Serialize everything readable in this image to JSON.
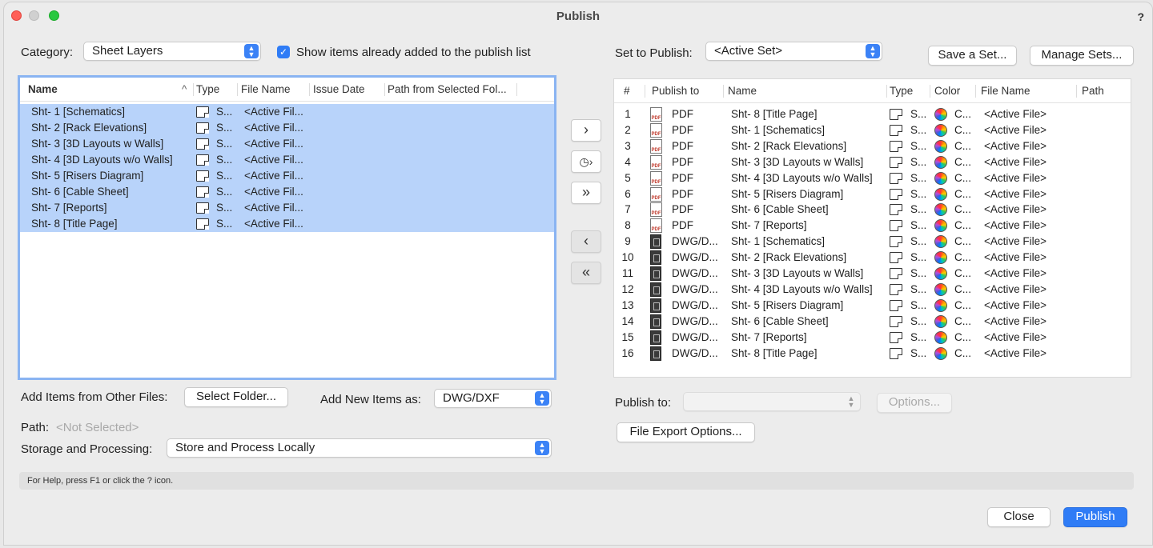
{
  "window": {
    "title": "Publish",
    "help": "?"
  },
  "left": {
    "category_label": "Category:",
    "category_value": "Sheet Layers",
    "show_items_label": "Show items already added to the publish list",
    "columns": [
      "Name",
      "Type",
      "File Name",
      "Issue Date",
      "Path from Selected Fol..."
    ],
    "rows": [
      {
        "name": "Sht- 1 [Schematics]",
        "type": "S...",
        "file": "<Active Fil..."
      },
      {
        "name": "Sht- 2 [Rack Elevations]",
        "type": "S...",
        "file": "<Active Fil..."
      },
      {
        "name": "Sht- 3 [3D Layouts w Walls]",
        "type": "S...",
        "file": "<Active Fil..."
      },
      {
        "name": "Sht- 4 [3D Layouts w/o Walls]",
        "type": "S...",
        "file": "<Active Fil..."
      },
      {
        "name": "Sht- 5 [Risers Diagram]",
        "type": "S...",
        "file": "<Active Fil..."
      },
      {
        "name": "Sht- 6 [Cable Sheet]",
        "type": "S...",
        "file": "<Active Fil..."
      },
      {
        "name": "Sht- 7 [Reports]",
        "type": "S...",
        "file": "<Active Fil..."
      },
      {
        "name": "Sht- 8 [Title Page]",
        "type": "S...",
        "file": "<Active Fil..."
      }
    ],
    "add_items_label": "Add Items from Other Files:",
    "select_folder": "Select Folder...",
    "add_new_label": "Add New Items as:",
    "add_new_value": "DWG/DXF",
    "path_label": "Path:",
    "path_value": "<Not Selected>",
    "storage_label": "Storage and Processing:",
    "storage_value": "Store and Process Locally"
  },
  "right": {
    "set_label": "Set to Publish:",
    "set_value": "<Active Set>",
    "save_set": "Save a Set...",
    "manage_sets": "Manage Sets...",
    "columns": [
      "#",
      "Publish to",
      "Name",
      "Type",
      "Color",
      "File Name",
      "Path"
    ],
    "rows": [
      {
        "num": "1",
        "publish": "PDF",
        "kind": "pdf",
        "name": "Sht- 8 [Title Page]",
        "type": "S...",
        "color": "C...",
        "file": "<Active File>"
      },
      {
        "num": "2",
        "publish": "PDF",
        "kind": "pdf",
        "name": "Sht- 1 [Schematics]",
        "type": "S...",
        "color": "C...",
        "file": "<Active File>"
      },
      {
        "num": "3",
        "publish": "PDF",
        "kind": "pdf",
        "name": "Sht- 2 [Rack Elevations]",
        "type": "S...",
        "color": "C...",
        "file": "<Active File>"
      },
      {
        "num": "4",
        "publish": "PDF",
        "kind": "pdf",
        "name": "Sht- 3 [3D Layouts w Walls]",
        "type": "S...",
        "color": "C...",
        "file": "<Active File>"
      },
      {
        "num": "5",
        "publish": "PDF",
        "kind": "pdf",
        "name": "Sht- 4 [3D Layouts w/o Walls]",
        "type": "S...",
        "color": "C...",
        "file": "<Active File>"
      },
      {
        "num": "6",
        "publish": "PDF",
        "kind": "pdf",
        "name": "Sht- 5 [Risers Diagram]",
        "type": "S...",
        "color": "C...",
        "file": "<Active File>"
      },
      {
        "num": "7",
        "publish": "PDF",
        "kind": "pdf",
        "name": "Sht- 6 [Cable Sheet]",
        "type": "S...",
        "color": "C...",
        "file": "<Active File>"
      },
      {
        "num": "8",
        "publish": "PDF",
        "kind": "pdf",
        "name": "Sht- 7 [Reports]",
        "type": "S...",
        "color": "C...",
        "file": "<Active File>"
      },
      {
        "num": "9",
        "publish": "DWG/D...",
        "kind": "dwg",
        "name": "Sht- 1 [Schematics]",
        "type": "S...",
        "color": "C...",
        "file": "<Active File>"
      },
      {
        "num": "10",
        "publish": "DWG/D...",
        "kind": "dwg",
        "name": "Sht- 2 [Rack Elevations]",
        "type": "S...",
        "color": "C...",
        "file": "<Active File>"
      },
      {
        "num": "11",
        "publish": "DWG/D...",
        "kind": "dwg",
        "name": "Sht- 3 [3D Layouts w Walls]",
        "type": "S...",
        "color": "C...",
        "file": "<Active File>"
      },
      {
        "num": "12",
        "publish": "DWG/D...",
        "kind": "dwg",
        "name": "Sht- 4 [3D Layouts w/o Walls]",
        "type": "S...",
        "color": "C...",
        "file": "<Active File>"
      },
      {
        "num": "13",
        "publish": "DWG/D...",
        "kind": "dwg",
        "name": "Sht- 5 [Risers Diagram]",
        "type": "S...",
        "color": "C...",
        "file": "<Active File>"
      },
      {
        "num": "14",
        "publish": "DWG/D...",
        "kind": "dwg",
        "name": "Sht- 6 [Cable Sheet]",
        "type": "S...",
        "color": "C...",
        "file": "<Active File>"
      },
      {
        "num": "15",
        "publish": "DWG/D...",
        "kind": "dwg",
        "name": "Sht- 7 [Reports]",
        "type": "S...",
        "color": "C...",
        "file": "<Active File>"
      },
      {
        "num": "16",
        "publish": "DWG/D...",
        "kind": "dwg",
        "name": "Sht- 8 [Title Page]",
        "type": "S...",
        "color": "C...",
        "file": "<Active File>"
      }
    ],
    "publish_to_label": "Publish to:",
    "publish_to_value": "",
    "options": "Options...",
    "file_export_options": "File Export Options..."
  },
  "status_text": "For Help, press F1 or click the ? icon.",
  "footer": {
    "close": "Close",
    "publish": "Publish"
  },
  "colors": {
    "accent": "#2f7cf6",
    "selection": "#b8d3fa"
  }
}
